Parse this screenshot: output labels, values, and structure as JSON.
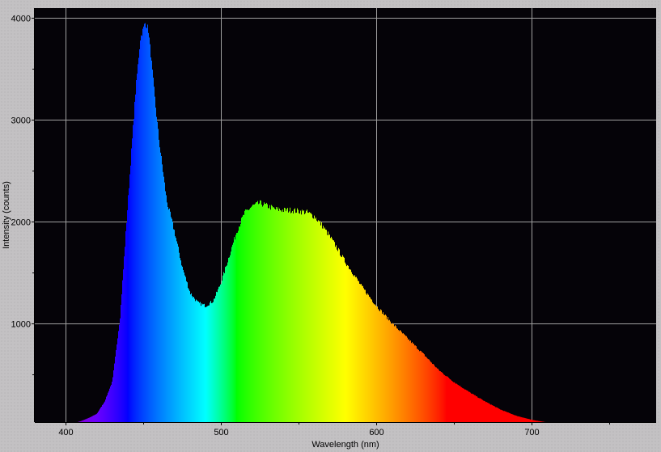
{
  "chart_data": {
    "type": "area",
    "title": "",
    "xlabel": "Wavelength (nm)",
    "ylabel": "Intensity (counts)",
    "xlim": [
      380,
      780
    ],
    "ylim": [
      28,
      4096
    ],
    "grid": true,
    "x_ticks": [
      400,
      500,
      600,
      700
    ],
    "y_ticks": [
      1000,
      2000,
      3000,
      4000
    ],
    "x_tick_labels": [
      "400",
      "500",
      "600",
      "700"
    ],
    "y_tick_labels": [
      "1000",
      "2000",
      "3000",
      "4000"
    ],
    "fill": "spectral wavelength colors",
    "plot_background": "#050308",
    "grid_color": "#a0a0a0",
    "series": [
      {
        "x": [
          380,
          400,
          405,
          410,
          415,
          420,
          425,
          430,
          435,
          440,
          445,
          448,
          451,
          453,
          455,
          458,
          460,
          465,
          470,
          475,
          480,
          485,
          490,
          495,
          500,
          505,
          510,
          515,
          520,
          525,
          530,
          535,
          540,
          545,
          550,
          555,
          560,
          565,
          570,
          575,
          580,
          585,
          590,
          595,
          600,
          610,
          620,
          630,
          640,
          650,
          660,
          670,
          680,
          690,
          700,
          710,
          720,
          740,
          760,
          780
        ],
        "y": [
          0,
          5,
          15,
          40,
          70,
          110,
          230,
          430,
          1070,
          2200,
          3300,
          3800,
          3950,
          3900,
          3600,
          3100,
          2800,
          2200,
          1900,
          1550,
          1300,
          1200,
          1170,
          1220,
          1400,
          1650,
          1900,
          2080,
          2150,
          2180,
          2150,
          2120,
          2110,
          2110,
          2100,
          2090,
          2050,
          1960,
          1850,
          1730,
          1600,
          1490,
          1370,
          1270,
          1170,
          1000,
          850,
          700,
          540,
          420,
          320,
          230,
          150,
          90,
          50,
          25,
          12,
          4,
          1,
          0
        ]
      }
    ]
  }
}
